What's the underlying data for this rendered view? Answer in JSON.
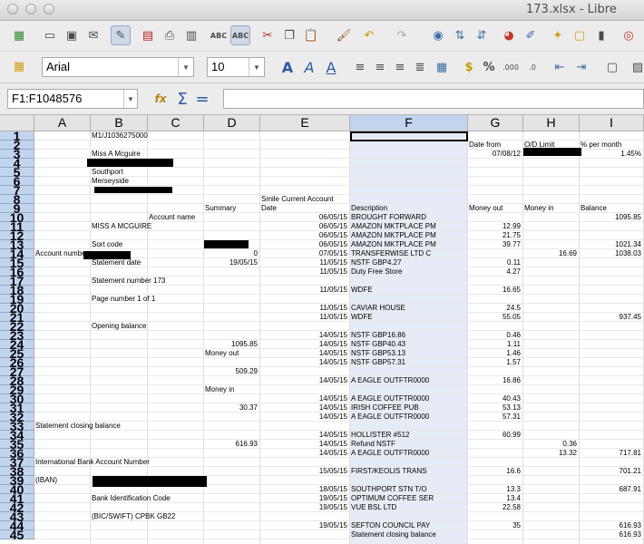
{
  "window": {
    "title": "173.xlsx - Libre"
  },
  "toolbar": {
    "font_name": "Arial",
    "font_size": "10",
    "icons": [
      "new-icon",
      "open-icon",
      "save-icon",
      "email-icon",
      "edit-mode-icon",
      "export-pdf-icon",
      "print-icon",
      "print-preview-icon",
      "spellcheck-icon",
      "autospellcheck-icon",
      "cut-icon",
      "copy-icon",
      "paste-icon",
      "clone-format-icon",
      "undo-icon",
      "redo-icon",
      "navigator-icon",
      "sort-ascending-icon",
      "sort-descending-icon",
      "chart-icon",
      "draw-icon",
      "star-icon",
      "comment-icon",
      "trash-icon",
      "help-icon"
    ]
  },
  "formula_bar": {
    "name_box": "F1:F1048576",
    "func_icon": "fx",
    "sum_icon": "Σ",
    "equals_icon": "=",
    "content": ""
  },
  "sheet": {
    "columns": [
      "A",
      "B",
      "C",
      "D",
      "E",
      "F",
      "G",
      "H",
      "I"
    ],
    "selected_column": "F",
    "rows": [
      {
        "n": "1",
        "cells": [
          {
            "col": "B",
            "text": "M1/J1036275000"
          }
        ]
      },
      {
        "n": "2",
        "cells": [
          {
            "col": "G",
            "text": "Date from"
          },
          {
            "col": "H",
            "text": "O/D Limit"
          },
          {
            "col": "I",
            "text": "% per month"
          }
        ]
      },
      {
        "n": "3",
        "cells": [
          {
            "col": "B",
            "text": "Miss A Mcguire"
          },
          {
            "col": "G",
            "text": "07/08/12",
            "align": "r"
          },
          {
            "col": "I",
            "text": "1.45%",
            "align": "r"
          }
        ]
      },
      {
        "n": "4",
        "cells": []
      },
      {
        "n": "5",
        "cells": [
          {
            "col": "B",
            "text": "Southport"
          }
        ]
      },
      {
        "n": "6",
        "cells": [
          {
            "col": "B",
            "text": "Merseyside"
          }
        ]
      },
      {
        "n": "7",
        "cells": []
      },
      {
        "n": "8",
        "cells": [
          {
            "col": "E",
            "text": "Smile Current Account"
          }
        ]
      },
      {
        "n": "9",
        "cells": [
          {
            "col": "D",
            "text": "Summary"
          },
          {
            "col": "E",
            "text": "Date"
          },
          {
            "col": "F",
            "text": "Description"
          },
          {
            "col": "G",
            "text": "Money out"
          },
          {
            "col": "H",
            "text": "Money in"
          },
          {
            "col": "I",
            "text": "Balance"
          }
        ]
      },
      {
        "n": "10",
        "cells": [
          {
            "col": "C",
            "text": "Account name"
          },
          {
            "col": "E",
            "text": "06/05/15",
            "align": "r"
          },
          {
            "col": "F",
            "text": "BROUGHT FORWARD"
          },
          {
            "col": "I",
            "text": "1095.85",
            "align": "r"
          }
        ]
      },
      {
        "n": "11",
        "cells": [
          {
            "col": "B",
            "text": "MISS A MCGUIRE"
          },
          {
            "col": "E",
            "text": "06/05/15",
            "align": "r"
          },
          {
            "col": "F",
            "text": "AMAZON MKTPLACE PM"
          },
          {
            "col": "G",
            "text": "12.99",
            "align": "r"
          }
        ]
      },
      {
        "n": "12",
        "cells": [
          {
            "col": "E",
            "text": "06/05/15",
            "align": "r"
          },
          {
            "col": "F",
            "text": "AMAZON MKTPLACE PM"
          },
          {
            "col": "G",
            "text": "21.75",
            "align": "r"
          }
        ]
      },
      {
        "n": "13",
        "cells": [
          {
            "col": "B",
            "text": "Sort code"
          },
          {
            "col": "E",
            "text": "06/05/15",
            "align": "r"
          },
          {
            "col": "F",
            "text": "AMAZON MKTPLACE PM"
          },
          {
            "col": "G",
            "text": "39.77",
            "align": "r"
          },
          {
            "col": "I",
            "text": "1021.34",
            "align": "r"
          }
        ]
      },
      {
        "n": "14",
        "cells": [
          {
            "col": "A",
            "text": "Account number"
          },
          {
            "col": "D",
            "text": "0",
            "align": "r"
          },
          {
            "col": "E",
            "text": "07/05/15",
            "align": "r"
          },
          {
            "col": "F",
            "text": "TRANSFERWISE LTD C"
          },
          {
            "col": "H",
            "text": "16.69",
            "align": "r"
          },
          {
            "col": "I",
            "text": "1038.03",
            "align": "r"
          }
        ]
      },
      {
        "n": "15",
        "cells": [
          {
            "col": "B",
            "text": "Statement date"
          },
          {
            "col": "D",
            "text": "19/05/15",
            "align": "r"
          },
          {
            "col": "E",
            "text": "11/05/15",
            "align": "r"
          },
          {
            "col": "F",
            "text": "NSTF GBP4.27"
          },
          {
            "col": "G",
            "text": "0.11",
            "align": "r"
          }
        ]
      },
      {
        "n": "16",
        "cells": [
          {
            "col": "E",
            "text": "11/05/15",
            "align": "r"
          },
          {
            "col": "F",
            "text": "Duty Free Store"
          },
          {
            "col": "G",
            "text": "4.27",
            "align": "r"
          }
        ]
      },
      {
        "n": "17",
        "cells": [
          {
            "col": "B",
            "text": "Statement number 173"
          }
        ]
      },
      {
        "n": "18",
        "cells": [
          {
            "col": "E",
            "text": "11/05/15",
            "align": "r"
          },
          {
            "col": "F",
            "text": "WDFE"
          },
          {
            "col": "G",
            "text": "16.65",
            "align": "r"
          }
        ]
      },
      {
        "n": "19",
        "cells": [
          {
            "col": "B",
            "text": "Page number 1 of 1"
          }
        ]
      },
      {
        "n": "20",
        "cells": [
          {
            "col": "E",
            "text": "11/05/15",
            "align": "r"
          },
          {
            "col": "F",
            "text": "CAVIAR HOUSE"
          },
          {
            "col": "G",
            "text": "24.5",
            "align": "r"
          }
        ]
      },
      {
        "n": "21",
        "cells": [
          {
            "col": "E",
            "text": "11/05/15",
            "align": "r"
          },
          {
            "col": "F",
            "text": "WDFE"
          },
          {
            "col": "G",
            "text": "55.05",
            "align": "r"
          },
          {
            "col": "I",
            "text": "937.45",
            "align": "r"
          }
        ]
      },
      {
        "n": "22",
        "cells": [
          {
            "col": "B",
            "text": "Opening balance"
          }
        ]
      },
      {
        "n": "23",
        "cells": [
          {
            "col": "E",
            "text": "14/05/15",
            "align": "r"
          },
          {
            "col": "F",
            "text": "NSTF GBP16.86"
          },
          {
            "col": "G",
            "text": "0.46",
            "align": "r"
          }
        ]
      },
      {
        "n": "24",
        "cells": [
          {
            "col": "D",
            "text": "1095.85",
            "align": "r"
          },
          {
            "col": "E",
            "text": "14/05/15",
            "align": "r"
          },
          {
            "col": "F",
            "text": "NSTF GBP40.43"
          },
          {
            "col": "G",
            "text": "1.11",
            "align": "r"
          }
        ]
      },
      {
        "n": "25",
        "cells": [
          {
            "col": "D",
            "text": "Money out"
          },
          {
            "col": "E",
            "text": "14/05/15",
            "align": "r"
          },
          {
            "col": "F",
            "text": "NSTF GBP53.13"
          },
          {
            "col": "G",
            "text": "1.46",
            "align": "r"
          }
        ]
      },
      {
        "n": "26",
        "cells": [
          {
            "col": "E",
            "text": "14/05/15",
            "align": "r"
          },
          {
            "col": "F",
            "text": "NSTF GBP57.31"
          },
          {
            "col": "G",
            "text": "1.57",
            "align": "r"
          }
        ]
      },
      {
        "n": "27",
        "cells": [
          {
            "col": "D",
            "text": "509.29",
            "align": "r"
          }
        ]
      },
      {
        "n": "28",
        "cells": [
          {
            "col": "E",
            "text": "14/05/15",
            "align": "r"
          },
          {
            "col": "F",
            "text": "A EAGLE OUTFTR0000"
          },
          {
            "col": "G",
            "text": "16.86",
            "align": "r"
          }
        ]
      },
      {
        "n": "29",
        "cells": [
          {
            "col": "D",
            "text": "Money in"
          }
        ]
      },
      {
        "n": "30",
        "cells": [
          {
            "col": "E",
            "text": "14/05/15",
            "align": "r"
          },
          {
            "col": "F",
            "text": "A EAGLE OUTFTR0000"
          },
          {
            "col": "G",
            "text": "40.43",
            "align": "r"
          }
        ]
      },
      {
        "n": "31",
        "cells": [
          {
            "col": "D",
            "text": "30.37",
            "align": "r"
          },
          {
            "col": "E",
            "text": "14/05/15",
            "align": "r"
          },
          {
            "col": "F",
            "text": "IRISH COFFEE PUB"
          },
          {
            "col": "G",
            "text": "53.13",
            "align": "r"
          }
        ]
      },
      {
        "n": "32",
        "cells": [
          {
            "col": "E",
            "text": "14/05/15",
            "align": "r"
          },
          {
            "col": "F",
            "text": "A EAGLE OUTFTR0000"
          },
          {
            "col": "G",
            "text": "57.31",
            "align": "r"
          }
        ]
      },
      {
        "n": "33",
        "cells": [
          {
            "col": "A",
            "text": "Statement closing balance"
          }
        ]
      },
      {
        "n": "34",
        "cells": [
          {
            "col": "E",
            "text": "14/05/15",
            "align": "r"
          },
          {
            "col": "F",
            "text": "HOLLISTER #512"
          },
          {
            "col": "G",
            "text": "60.99",
            "align": "r"
          }
        ]
      },
      {
        "n": "35",
        "cells": [
          {
            "col": "D",
            "text": "616.93",
            "align": "r"
          },
          {
            "col": "E",
            "text": "14/05/15",
            "align": "r"
          },
          {
            "col": "F",
            "text": "Refund NSTF"
          },
          {
            "col": "H",
            "text": "0.36",
            "align": "r"
          }
        ]
      },
      {
        "n": "36",
        "cells": [
          {
            "col": "E",
            "text": "14/05/15",
            "align": "r"
          },
          {
            "col": "F",
            "text": "A EAGLE OUTFTR0000"
          },
          {
            "col": "H",
            "text": "13.32",
            "align": "r"
          },
          {
            "col": "I",
            "text": "717.81",
            "align": "r"
          }
        ]
      },
      {
        "n": "37",
        "cells": [
          {
            "col": "A",
            "text": "International Bank Account Number"
          }
        ]
      },
      {
        "n": "38",
        "cells": [
          {
            "col": "E",
            "text": "15/05/15",
            "align": "r"
          },
          {
            "col": "F",
            "text": "FIRST/KEOLIS TRANS"
          },
          {
            "col": "G",
            "text": "16.6",
            "align": "r"
          },
          {
            "col": "I",
            "text": "701.21",
            "align": "r"
          }
        ]
      },
      {
        "n": "39",
        "cells": [
          {
            "col": "A",
            "text": "(IBAN)"
          }
        ]
      },
      {
        "n": "40",
        "cells": [
          {
            "col": "E",
            "text": "18/05/15",
            "align": "r"
          },
          {
            "col": "F",
            "text": "SOUTHPORT STN T/O"
          },
          {
            "col": "G",
            "text": "13.3",
            "align": "r"
          },
          {
            "col": "I",
            "text": "687.91",
            "align": "r"
          }
        ]
      },
      {
        "n": "41",
        "cells": [
          {
            "col": "B",
            "text": "Bank Identification Code"
          },
          {
            "col": "E",
            "text": "19/05/15",
            "align": "r"
          },
          {
            "col": "F",
            "text": "OPTIMUM COFFEE SER"
          },
          {
            "col": "G",
            "text": "13.4",
            "align": "r"
          }
        ]
      },
      {
        "n": "42",
        "cells": [
          {
            "col": "E",
            "text": "19/05/15",
            "align": "r"
          },
          {
            "col": "F",
            "text": "VUE BSL LTD"
          },
          {
            "col": "G",
            "text": "22.58",
            "align": "r"
          }
        ]
      },
      {
        "n": "43",
        "cells": [
          {
            "col": "B",
            "text": "(BIC/SWIFT) CPBK GB22"
          }
        ]
      },
      {
        "n": "44",
        "cells": [
          {
            "col": "E",
            "text": "19/05/15",
            "align": "r"
          },
          {
            "col": "F",
            "text": "SEFTON COUNCIL PAY"
          },
          {
            "col": "G",
            "text": "35",
            "align": "r"
          },
          {
            "col": "I",
            "text": "616.93",
            "align": "r"
          }
        ]
      },
      {
        "n": "45",
        "cells": [
          {
            "col": "F",
            "text": "Statement closing balance"
          },
          {
            "col": "I",
            "text": "616.93",
            "align": "r"
          }
        ]
      }
    ]
  }
}
